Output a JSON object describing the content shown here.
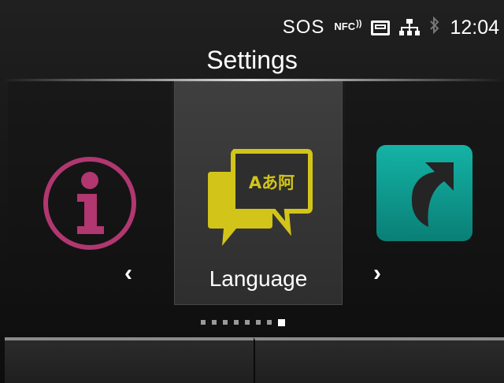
{
  "status_bar": {
    "sos": "SOS",
    "nfc": "NFC",
    "icons": [
      "nfc-icon",
      "sd-card-icon",
      "lan-icon",
      "bluetooth-icon"
    ],
    "time": "12:04"
  },
  "header": {
    "title": "Settings"
  },
  "carousel": {
    "items": [
      {
        "icon": "info-icon",
        "color": "#b0376f"
      },
      {
        "icon": "language-icon",
        "label": "Language",
        "color": "#d2c419",
        "selected": true
      },
      {
        "icon": "shortcut-icon",
        "color": "#0f9e93"
      }
    ],
    "prev": "‹",
    "next": "›"
  },
  "pager": {
    "total": 8,
    "current": 8
  },
  "language_icon_text": "Aあ阿"
}
